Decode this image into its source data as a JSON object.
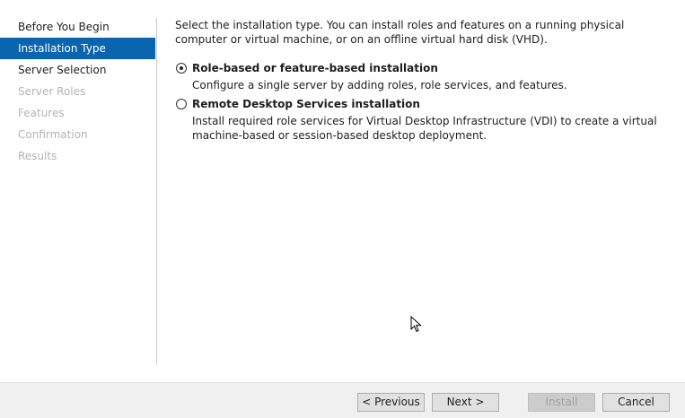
{
  "nav": {
    "items": [
      {
        "label": "Before You Begin",
        "state": "normal"
      },
      {
        "label": "Installation Type",
        "state": "selected"
      },
      {
        "label": "Server Selection",
        "state": "normal"
      },
      {
        "label": "Server Roles",
        "state": "disabled"
      },
      {
        "label": "Features",
        "state": "disabled"
      },
      {
        "label": "Confirmation",
        "state": "disabled"
      },
      {
        "label": "Results",
        "state": "disabled"
      }
    ]
  },
  "main": {
    "intro": "Select the installation type. You can install roles and features on a running physical computer or virtual machine, or on an offline virtual hard disk (VHD).",
    "options": [
      {
        "title": "Role-based or feature-based installation",
        "description": "Configure a single server by adding roles, role services, and features.",
        "checked": true
      },
      {
        "title": "Remote Desktop Services installation",
        "description": "Install required role services for Virtual Desktop Infrastructure (VDI) to create a virtual machine-based or session-based desktop deployment.",
        "checked": false
      }
    ]
  },
  "footer": {
    "previous_label": "< Previous",
    "next_label": "Next >",
    "install_label": "Install",
    "cancel_label": "Cancel"
  },
  "colors": {
    "selected_bg": "#0a64b0",
    "disabled_text": "#b4b4b4",
    "footer_bg": "#f0f0f0"
  },
  "icons": {
    "cursor": "mouse-pointer-icon"
  }
}
